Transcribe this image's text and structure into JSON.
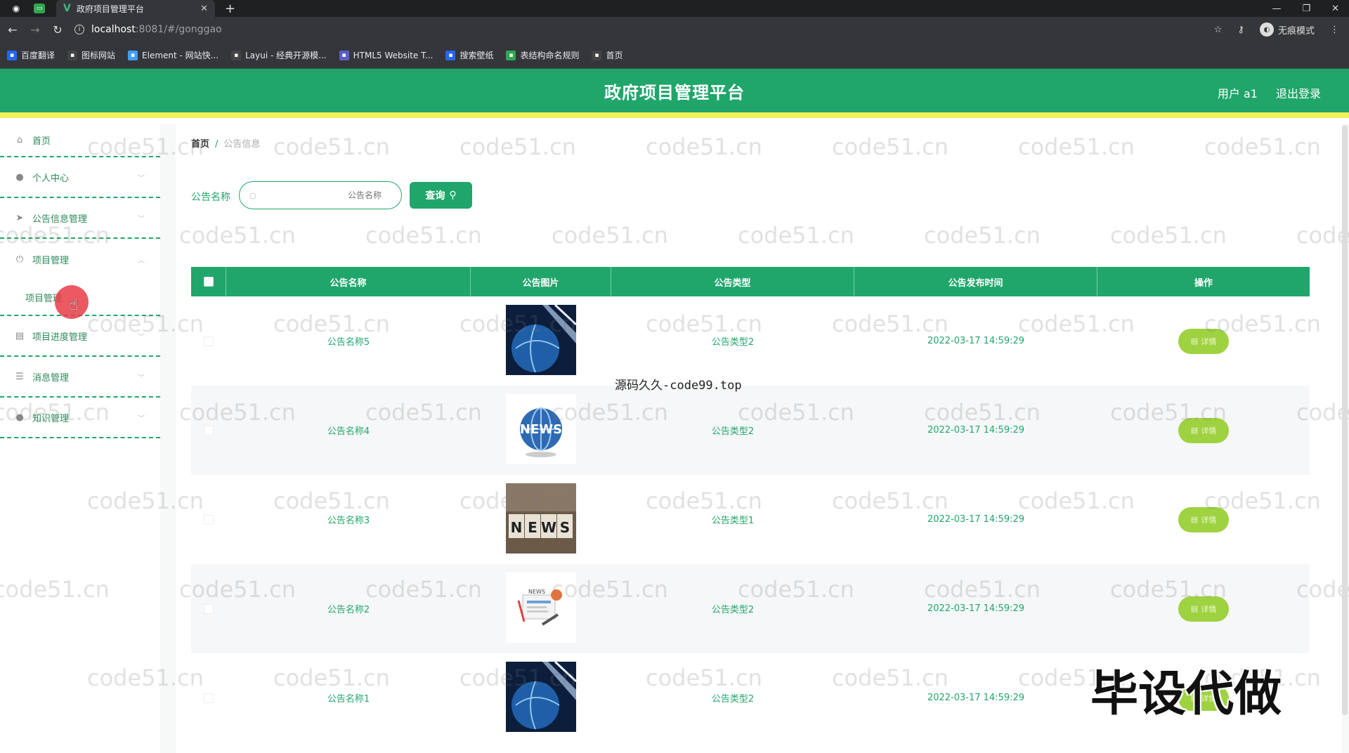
{
  "browser": {
    "tab_title": "政府项目管理平台",
    "address_host": "localhost",
    "address_path": ":8081/#/gonggao",
    "incognito_label": "无痕模式",
    "bookmarks": [
      {
        "label": "百度翻译",
        "icon": "translate-icon",
        "color": "#2468f2"
      },
      {
        "label": "图标网站",
        "icon": "flag-icon",
        "color": "#444444"
      },
      {
        "label": "Element - 网站快...",
        "icon": "element-icon",
        "color": "#409eff"
      },
      {
        "label": "Layui - 经典开源模...",
        "icon": "layui-icon",
        "color": "#444444"
      },
      {
        "label": "HTML5 Website T...",
        "icon": "html5-icon",
        "color": "#5b5fc7"
      },
      {
        "label": "搜索壁纸",
        "icon": "wallpaper-icon",
        "color": "#2468f2"
      },
      {
        "label": "表结构命名规则",
        "icon": "doc-icon",
        "color": "#2fa84f"
      },
      {
        "label": "首页",
        "icon": "github-icon",
        "color": "#444444"
      }
    ]
  },
  "header": {
    "title": "政府项目管理平台",
    "user_label": "用户 a1",
    "logout_label": "退出登录"
  },
  "sidebar": {
    "items": [
      {
        "label": "首页",
        "icon": "home-icon"
      },
      {
        "label": "个人中心",
        "icon": "user-icon"
      },
      {
        "label": "公告信息管理",
        "icon": "send-icon"
      },
      {
        "label": "项目管理",
        "icon": "power-icon"
      },
      {
        "label": "项目进度管理",
        "icon": "progress-icon"
      },
      {
        "label": "消息管理",
        "icon": "list-icon"
      },
      {
        "label": "知识管理",
        "icon": "knowledge-icon"
      }
    ],
    "submenu_label": "项目管理"
  },
  "breadcrumb": {
    "home": "首页",
    "separator": "/",
    "current": "公告信息"
  },
  "search": {
    "label": "公告名称",
    "placeholder": "公告名称",
    "button_label": "查询"
  },
  "table": {
    "headers": [
      "公告名称",
      "公告图片",
      "公告类型",
      "公告发布时间",
      "操作"
    ],
    "detail_label": "详情",
    "rows": [
      {
        "name": "公告名称5",
        "image": "globe-tech",
        "type": "公告类型2",
        "time": "2022-03-17 14:59:29"
      },
      {
        "name": "公告名称4",
        "image": "news-globe",
        "type": "公告类型2",
        "time": "2022-03-17 14:59:29"
      },
      {
        "name": "公告名称3",
        "image": "news-blocks",
        "type": "公告类型1",
        "time": "2022-03-17 14:59:29"
      },
      {
        "name": "公告名称2",
        "image": "news-clipart",
        "type": "公告类型2",
        "time": "2022-03-17 14:59:29"
      },
      {
        "name": "公告名称1",
        "image": "globe-tech",
        "type": "公告类型2",
        "time": "2022-03-17 14:59:29"
      }
    ]
  },
  "overlay": {
    "watermark": "code51.cn",
    "source_text": "源码久久-code99.top",
    "stamp_text": "毕设代做"
  },
  "colors": {
    "primary": "#20a66b",
    "accent_strip": "#f0f05a",
    "detail_button": "#9ed240"
  }
}
